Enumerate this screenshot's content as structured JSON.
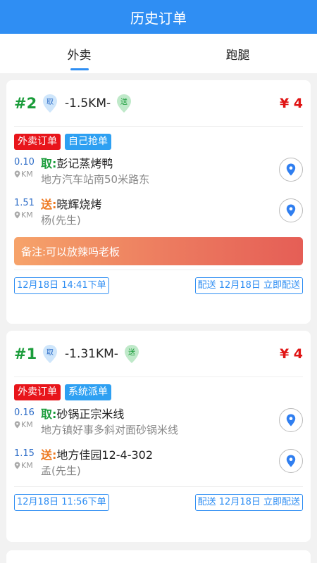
{
  "header": {
    "title": "历史订单"
  },
  "tabs": [
    {
      "label": "外卖",
      "active": true
    },
    {
      "label": "跑腿",
      "active": false
    }
  ],
  "pins": {
    "pick": "取",
    "send": "送"
  },
  "km_unit": "KM",
  "colors": {
    "primary": "#2f8ef3",
    "pick": "#1a9c3a",
    "send": "#ee7a22",
    "price": "#e01515"
  },
  "orders": [
    {
      "number": "#2",
      "distance": "-1.5KM-",
      "price": "¥ 4",
      "badges": [
        "外卖订单",
        "自己抢单"
      ],
      "pickup": {
        "dist": "0.10",
        "tag": "取:",
        "name": "彭记蒸烤鸭",
        "address": "地方汽车站南50米路东"
      },
      "delivery": {
        "dist": "1.51",
        "tag": "送:",
        "name": "晓辉烧烤",
        "contact": "杨(先生)"
      },
      "note": "备注:可以放辣吗老板",
      "order_time": "12月18日 14:41下单",
      "delivery_time": "配送 12月18日 立即配送"
    },
    {
      "number": "#1",
      "distance": "-1.31KM-",
      "price": "¥ 4",
      "badges": [
        "外卖订单",
        "系统派单"
      ],
      "pickup": {
        "dist": "0.16",
        "tag": "取:",
        "name": "砂锅正宗米线",
        "address": "地方镇好事多斜对面砂锅米线"
      },
      "delivery": {
        "dist": "1.15",
        "tag": "送:",
        "name": "地方佳园12-4-302",
        "contact": "孟(先生)"
      },
      "note": null,
      "order_time": "12月18日 11:56下单",
      "delivery_time": "配送 12月18日 立即配送"
    }
  ]
}
